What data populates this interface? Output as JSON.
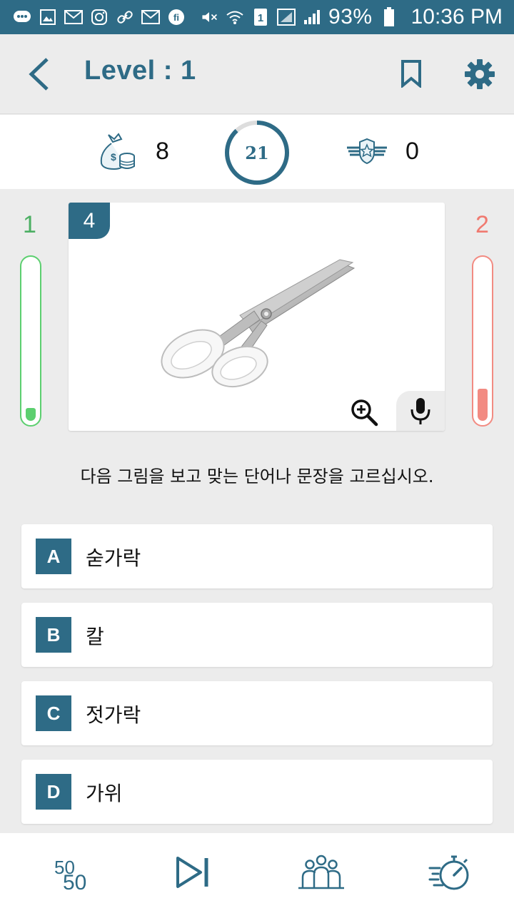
{
  "status_bar": {
    "battery_percent": "93%",
    "time": "10:36 PM",
    "sim_slot": "1"
  },
  "header": {
    "title": "Level : 1",
    "back_icon": "chevron-left-icon",
    "bookmark_icon": "bookmark-icon",
    "settings_icon": "gear-icon"
  },
  "score": {
    "coins": "8",
    "timer": "21",
    "timer_progress": 0.88,
    "badges": "0"
  },
  "meters": {
    "correct_count": "1",
    "correct_level": 0.08,
    "wrong_count": "2",
    "wrong_level": 0.2
  },
  "question": {
    "number": "4",
    "image": "scissors",
    "prompt": "다음 그림을 보고 맞는 단어나 문장을 고르십시오."
  },
  "answers": [
    {
      "letter": "A",
      "text": "숟가락"
    },
    {
      "letter": "B",
      "text": "칼"
    },
    {
      "letter": "C",
      "text": "젓가락"
    },
    {
      "letter": "D",
      "text": "가위"
    }
  ],
  "bottom_tools": {
    "fifty_top": "50",
    "fifty_bottom": "50",
    "skip_icon": "skip-icon",
    "audience_icon": "audience-icon",
    "timer_icon": "stopwatch-icon"
  },
  "colors": {
    "primary": "#2e6b86",
    "correct": "#5ccf6f",
    "wrong": "#f28b82",
    "background": "#ececec"
  }
}
